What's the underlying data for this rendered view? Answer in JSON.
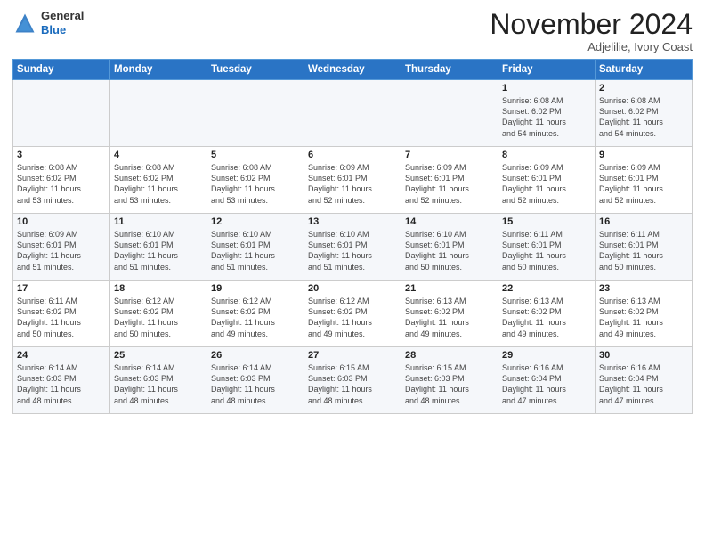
{
  "header": {
    "logo_line1": "General",
    "logo_line2": "Blue",
    "month": "November 2024",
    "location": "Adjelilie, Ivory Coast"
  },
  "days_of_week": [
    "Sunday",
    "Monday",
    "Tuesday",
    "Wednesday",
    "Thursday",
    "Friday",
    "Saturday"
  ],
  "weeks": [
    [
      {
        "day": "",
        "info": ""
      },
      {
        "day": "",
        "info": ""
      },
      {
        "day": "",
        "info": ""
      },
      {
        "day": "",
        "info": ""
      },
      {
        "day": "",
        "info": ""
      },
      {
        "day": "1",
        "info": "Sunrise: 6:08 AM\nSunset: 6:02 PM\nDaylight: 11 hours\nand 54 minutes."
      },
      {
        "day": "2",
        "info": "Sunrise: 6:08 AM\nSunset: 6:02 PM\nDaylight: 11 hours\nand 54 minutes."
      }
    ],
    [
      {
        "day": "3",
        "info": "Sunrise: 6:08 AM\nSunset: 6:02 PM\nDaylight: 11 hours\nand 53 minutes."
      },
      {
        "day": "4",
        "info": "Sunrise: 6:08 AM\nSunset: 6:02 PM\nDaylight: 11 hours\nand 53 minutes."
      },
      {
        "day": "5",
        "info": "Sunrise: 6:08 AM\nSunset: 6:02 PM\nDaylight: 11 hours\nand 53 minutes."
      },
      {
        "day": "6",
        "info": "Sunrise: 6:09 AM\nSunset: 6:01 PM\nDaylight: 11 hours\nand 52 minutes."
      },
      {
        "day": "7",
        "info": "Sunrise: 6:09 AM\nSunset: 6:01 PM\nDaylight: 11 hours\nand 52 minutes."
      },
      {
        "day": "8",
        "info": "Sunrise: 6:09 AM\nSunset: 6:01 PM\nDaylight: 11 hours\nand 52 minutes."
      },
      {
        "day": "9",
        "info": "Sunrise: 6:09 AM\nSunset: 6:01 PM\nDaylight: 11 hours\nand 52 minutes."
      }
    ],
    [
      {
        "day": "10",
        "info": "Sunrise: 6:09 AM\nSunset: 6:01 PM\nDaylight: 11 hours\nand 51 minutes."
      },
      {
        "day": "11",
        "info": "Sunrise: 6:10 AM\nSunset: 6:01 PM\nDaylight: 11 hours\nand 51 minutes."
      },
      {
        "day": "12",
        "info": "Sunrise: 6:10 AM\nSunset: 6:01 PM\nDaylight: 11 hours\nand 51 minutes."
      },
      {
        "day": "13",
        "info": "Sunrise: 6:10 AM\nSunset: 6:01 PM\nDaylight: 11 hours\nand 51 minutes."
      },
      {
        "day": "14",
        "info": "Sunrise: 6:10 AM\nSunset: 6:01 PM\nDaylight: 11 hours\nand 50 minutes."
      },
      {
        "day": "15",
        "info": "Sunrise: 6:11 AM\nSunset: 6:01 PM\nDaylight: 11 hours\nand 50 minutes."
      },
      {
        "day": "16",
        "info": "Sunrise: 6:11 AM\nSunset: 6:01 PM\nDaylight: 11 hours\nand 50 minutes."
      }
    ],
    [
      {
        "day": "17",
        "info": "Sunrise: 6:11 AM\nSunset: 6:02 PM\nDaylight: 11 hours\nand 50 minutes."
      },
      {
        "day": "18",
        "info": "Sunrise: 6:12 AM\nSunset: 6:02 PM\nDaylight: 11 hours\nand 50 minutes."
      },
      {
        "day": "19",
        "info": "Sunrise: 6:12 AM\nSunset: 6:02 PM\nDaylight: 11 hours\nand 49 minutes."
      },
      {
        "day": "20",
        "info": "Sunrise: 6:12 AM\nSunset: 6:02 PM\nDaylight: 11 hours\nand 49 minutes."
      },
      {
        "day": "21",
        "info": "Sunrise: 6:13 AM\nSunset: 6:02 PM\nDaylight: 11 hours\nand 49 minutes."
      },
      {
        "day": "22",
        "info": "Sunrise: 6:13 AM\nSunset: 6:02 PM\nDaylight: 11 hours\nand 49 minutes."
      },
      {
        "day": "23",
        "info": "Sunrise: 6:13 AM\nSunset: 6:02 PM\nDaylight: 11 hours\nand 49 minutes."
      }
    ],
    [
      {
        "day": "24",
        "info": "Sunrise: 6:14 AM\nSunset: 6:03 PM\nDaylight: 11 hours\nand 48 minutes."
      },
      {
        "day": "25",
        "info": "Sunrise: 6:14 AM\nSunset: 6:03 PM\nDaylight: 11 hours\nand 48 minutes."
      },
      {
        "day": "26",
        "info": "Sunrise: 6:14 AM\nSunset: 6:03 PM\nDaylight: 11 hours\nand 48 minutes."
      },
      {
        "day": "27",
        "info": "Sunrise: 6:15 AM\nSunset: 6:03 PM\nDaylight: 11 hours\nand 48 minutes."
      },
      {
        "day": "28",
        "info": "Sunrise: 6:15 AM\nSunset: 6:03 PM\nDaylight: 11 hours\nand 48 minutes."
      },
      {
        "day": "29",
        "info": "Sunrise: 6:16 AM\nSunset: 6:04 PM\nDaylight: 11 hours\nand 47 minutes."
      },
      {
        "day": "30",
        "info": "Sunrise: 6:16 AM\nSunset: 6:04 PM\nDaylight: 11 hours\nand 47 minutes."
      }
    ]
  ]
}
